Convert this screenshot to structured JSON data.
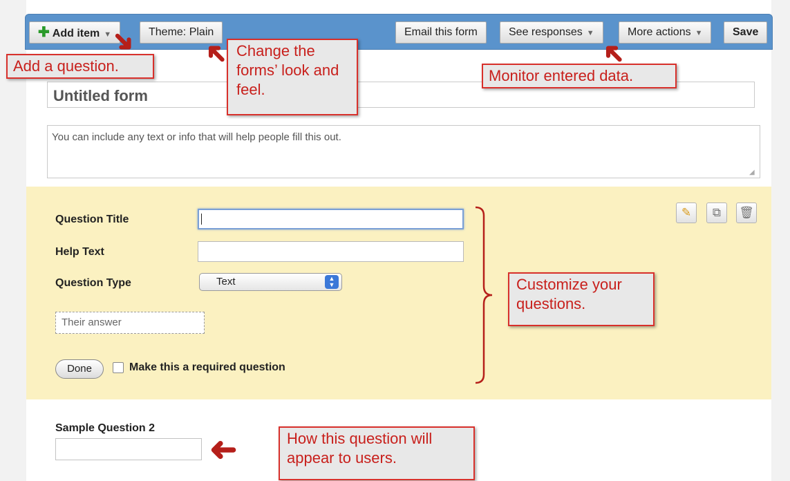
{
  "toolbar": {
    "add_item": "Add item",
    "theme": "Theme:  Plain",
    "email": "Email this form",
    "see_responses": "See responses",
    "more_actions": "More actions",
    "save": "Save"
  },
  "form": {
    "title": "Untitled form",
    "description": "You can include any text or info that will help people fill this out."
  },
  "question_editor": {
    "title_label": "Question Title",
    "help_label": "Help Text",
    "type_label": "Question Type",
    "type_value": "Text",
    "answer_placeholder": "Their answer",
    "done_label": "Done",
    "required_label": "Make this a required question"
  },
  "sample": {
    "title": "Sample Question 2"
  },
  "callouts": {
    "add_question": "Add a question.",
    "change_look": "Change the forms’ look and feel.",
    "monitor": "Monitor entered data.",
    "customize": "Customize your questions.",
    "appear": "How this question will appear to users."
  },
  "colors": {
    "toolbar": "#5a93cc",
    "editor_bg": "#fbf1c1",
    "callout_border": "#d8302b",
    "callout_text": "#c8201c",
    "arrow": "#b51f1a"
  },
  "icons": [
    "plus-icon",
    "pencil-icon",
    "duplicate-icon",
    "trash-icon",
    "arrow-icon"
  ]
}
